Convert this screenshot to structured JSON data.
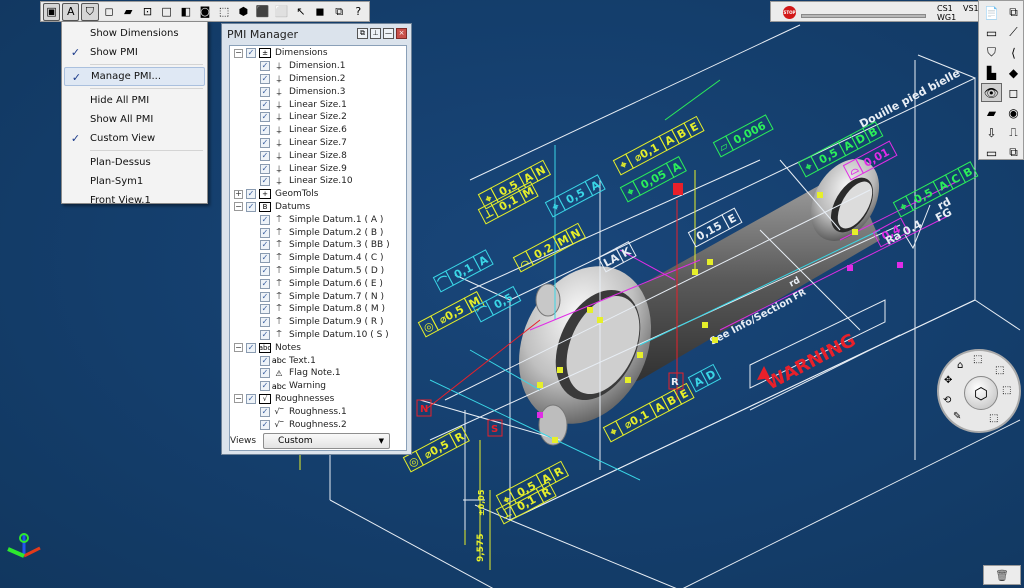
{
  "colors": {
    "viewport_bg": "#143e6c",
    "pmi_yellow": "#e6ef2a",
    "pmi_cyan": "#3ad6e6",
    "pmi_green": "#2bef5a",
    "pmi_magenta": "#e02ce6",
    "pmi_white": "#e8eef5",
    "pmi_red": "#e8202a"
  },
  "top_toolbar": {
    "buttons": [
      {
        "name": "wireframe-view",
        "glyph": "▣",
        "pressed": true
      },
      {
        "name": "annotation-view",
        "glyph": "A",
        "pressed": true
      },
      {
        "name": "shield-view",
        "glyph": "⛉",
        "pressed": true
      },
      {
        "name": "cube-outline",
        "glyph": "◻",
        "pressed": false
      },
      {
        "name": "shaded-face",
        "glyph": "▰",
        "pressed": false
      },
      {
        "name": "select-box",
        "glyph": "⊡",
        "pressed": false
      },
      {
        "name": "empty-box",
        "glyph": "□",
        "pressed": false
      },
      {
        "name": "colored-shape",
        "glyph": "◧",
        "pressed": false
      },
      {
        "name": "capture",
        "glyph": "◙",
        "pressed": false
      },
      {
        "name": "yellow-cube",
        "glyph": "⬚",
        "pressed": false
      },
      {
        "name": "highlight-cube",
        "glyph": "⬢",
        "pressed": false
      },
      {
        "name": "green-cube",
        "glyph": "⬛",
        "pressed": false
      },
      {
        "name": "material-cube",
        "glyph": "⬜",
        "pressed": false
      },
      {
        "name": "pointer-line",
        "glyph": "↖",
        "pressed": false
      },
      {
        "name": "layers",
        "glyph": "◼",
        "pressed": false
      },
      {
        "name": "insert-part",
        "glyph": "⧉",
        "pressed": false
      },
      {
        "name": "whats-this",
        "glyph": "?",
        "pressed": false
      }
    ]
  },
  "status": {
    "stop_label": "STOP",
    "cs": "CS1",
    "wg": "WG1",
    "vs": "VS1"
  },
  "right_toolbar": {
    "buttons": [
      "📄",
      "⧉",
      "▭",
      "⟋",
      "⛉",
      "⟨",
      "▙",
      "◆",
      "👁",
      "◻",
      "▰",
      "◉",
      "⇩",
      "⎍",
      "▭",
      "⧉"
    ]
  },
  "menu": {
    "items": [
      {
        "label": "Show Dimensions",
        "checked": false
      },
      {
        "label": "Show PMI",
        "checked": true
      },
      {
        "sep": true
      },
      {
        "label": "Manage PMI...",
        "checked": true,
        "highlighted": true
      },
      {
        "sep": true
      },
      {
        "label": "Hide All PMI",
        "checked": false
      },
      {
        "label": "Show All PMI",
        "checked": false
      },
      {
        "label": "Custom View",
        "checked": true
      },
      {
        "sep": true
      },
      {
        "label": "Plan-Dessus",
        "checked": false
      },
      {
        "label": "Plan-Sym1",
        "checked": false
      },
      {
        "label": "Front View.1",
        "checked": false
      }
    ]
  },
  "pmi_manager": {
    "title": "PMI Manager",
    "tree": [
      {
        "label": "Dimensions",
        "expanded": true,
        "icon": "±",
        "children": [
          {
            "label": "Dimension.1",
            "icon": "dim"
          },
          {
            "label": "Dimension.2",
            "icon": "dim"
          },
          {
            "label": "Dimension.3",
            "icon": "dim"
          },
          {
            "label": "Linear Size.1",
            "icon": "dim"
          },
          {
            "label": "Linear Size.2",
            "icon": "dim"
          },
          {
            "label": "Linear Size.6",
            "icon": "dim"
          },
          {
            "label": "Linear Size.7",
            "icon": "dim"
          },
          {
            "label": "Linear Size.8",
            "icon": "dim"
          },
          {
            "label": "Linear Size.9",
            "icon": "dim"
          },
          {
            "label": "Linear Size.10",
            "icon": "dim"
          }
        ]
      },
      {
        "label": "GeomTols",
        "expanded": false,
        "icon": "+",
        "children": []
      },
      {
        "label": "Datums",
        "expanded": true,
        "icon": "B",
        "children": [
          {
            "label": "Simple Datum.1 ( A )",
            "icon": "datum"
          },
          {
            "label": "Simple Datum.2 ( B )",
            "icon": "datum"
          },
          {
            "label": "Simple Datum.3 ( BB )",
            "icon": "datum"
          },
          {
            "label": "Simple Datum.4 ( C )",
            "icon": "datum"
          },
          {
            "label": "Simple Datum.5 ( D )",
            "icon": "datum"
          },
          {
            "label": "Simple Datum.6 ( E )",
            "icon": "datum"
          },
          {
            "label": "Simple Datum.7 ( N )",
            "icon": "datum"
          },
          {
            "label": "Simple Datum.8 ( M )",
            "icon": "datum"
          },
          {
            "label": "Simple Datum.9 ( R )",
            "icon": "datum"
          },
          {
            "label": "Simple Datum.10 ( S )",
            "icon": "datum"
          }
        ]
      },
      {
        "label": "Notes",
        "expanded": true,
        "icon": "abc",
        "children": [
          {
            "label": "Text.1",
            "icon": "abc"
          },
          {
            "label": "Flag Note.1",
            "icon": "flag"
          },
          {
            "label": "Warning",
            "icon": "abc"
          }
        ]
      },
      {
        "label": "Roughnesses",
        "expanded": true,
        "icon": "√",
        "children": [
          {
            "label": "Roughness.1",
            "icon": "rough"
          },
          {
            "label": "Roughness.2",
            "icon": "rough"
          }
        ]
      }
    ],
    "views_label": "Views",
    "views_selected": "Custom"
  },
  "viewport": {
    "annotations": {
      "fcf_top": {
        "value": "0,1",
        "datums": [
          "A",
          "B",
          "E"
        ]
      },
      "fcf_left_1": {
        "value": "0,5",
        "datums": [
          "A",
          "N"
        ]
      },
      "fcf_left_2": {
        "value": "0,1",
        "datums": [
          "M"
        ]
      },
      "fcf_cyan_1": {
        "value": "0,5",
        "datums": [
          "A"
        ]
      },
      "fcf_cyan_2": {
        "value": "0,1",
        "datums": [
          "A"
        ]
      },
      "fcf_profile": {
        "value": "0,2",
        "datums": [
          "M",
          "N"
        ]
      },
      "fcf_conc": {
        "value": "0,5",
        "datums": [
          "M"
        ]
      },
      "fcf_green_flat": {
        "value": "0,006"
      },
      "fcf_green_pos": {
        "value": "0,5",
        "datums": [
          "A",
          "D",
          "B"
        ]
      },
      "fcf_magenta": {
        "value": "0,01"
      },
      "fcf_green_right": {
        "value": "0,5",
        "datums": [
          "A",
          "C",
          "B"
        ]
      },
      "dim_015": {
        "value": "0,15",
        "datum": "E"
      },
      "dim_la": {
        "value": "LA",
        "datum": "K"
      },
      "fcf_bottom_r": {
        "value": "0,5",
        "datums": [
          "R"
        ]
      },
      "fcf_bottom_mid": {
        "value": "0,5",
        "value2": "0,1",
        "datums": [
          "A",
          "R",
          "R"
        ]
      },
      "fcf_bottom_right": {
        "value": "0,1",
        "datums": [
          "A",
          "B",
          "E"
        ]
      },
      "dim_vertical": "9,575",
      "datum_r": "R",
      "datum_n": "N",
      "datum_s": "S",
      "datum_a": "A",
      "datum_d": "D",
      "note_douille": "Douille pied bielle",
      "note_see": "See Info/Section",
      "rough_fr": "FR",
      "rough_fg": "FG",
      "rough_rd": "rd",
      "rough_ra": "Ra 0.4",
      "warning": "WARNING"
    }
  }
}
